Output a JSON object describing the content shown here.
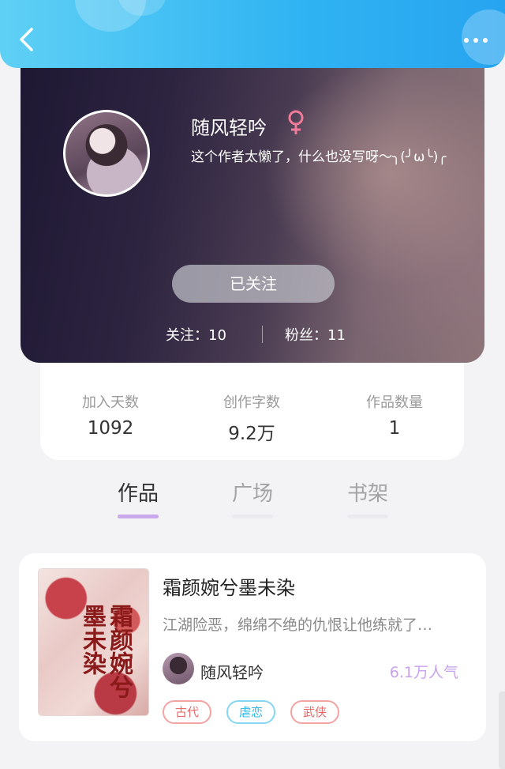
{
  "header": {
    "back_icon": "chevron-left-icon",
    "more_icon": "more-dots-icon",
    "colors": {
      "from": "#5fd0f5",
      "to": "#27a4f0"
    }
  },
  "profile": {
    "username": "随风轻吟",
    "gender_icon": "female-icon",
    "gender_color": "#f07a9a",
    "bio": "这个作者太懒了，什么也没写呀～╮(╯ω╰)╭",
    "follow_button_label": "已关注",
    "following_text": "关注：10",
    "fans_text": "粉丝：11"
  },
  "stats": [
    {
      "label": "加入天数",
      "value": "1092"
    },
    {
      "label": "创作字数",
      "value": "9.2万"
    },
    {
      "label": "作品数量",
      "value": "1"
    }
  ],
  "tabs": [
    {
      "label": "作品",
      "active": true
    },
    {
      "label": "广场",
      "active": false
    },
    {
      "label": "书架",
      "active": false
    }
  ],
  "books": [
    {
      "cover_title": "霜颜婉兮墨未染",
      "title": "霜颜婉兮墨未染",
      "description": "江湖险恶，绵绵不绝的仇恨让他练就了…",
      "author": "随风轻吟",
      "popularity": "6.1万人气",
      "tags": [
        "古代",
        "虐恋",
        "武侠"
      ]
    }
  ],
  "colors": {
    "accent": "#c9a8ec",
    "background": "#f3f3f5"
  }
}
